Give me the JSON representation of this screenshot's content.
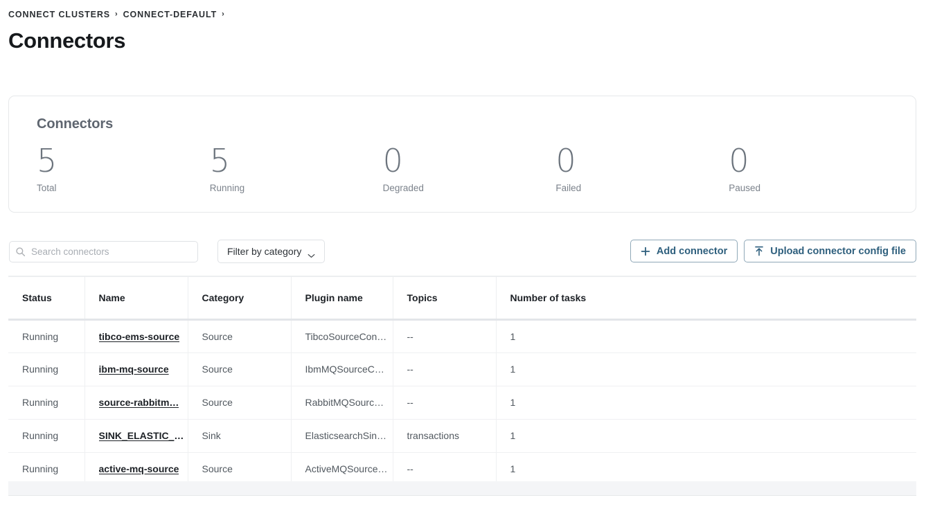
{
  "breadcrumb": {
    "items": [
      "CONNECT CLUSTERS",
      "CONNECT-DEFAULT"
    ],
    "separator": "›"
  },
  "page_title": "Connectors",
  "summary_card": {
    "title": "Connectors",
    "stats": [
      {
        "value": "5",
        "label": "Total"
      },
      {
        "value": "5",
        "label": "Running"
      },
      {
        "value": "0",
        "label": "Degraded"
      },
      {
        "value": "0",
        "label": "Failed"
      },
      {
        "value": "0",
        "label": "Paused"
      }
    ]
  },
  "toolbar": {
    "search_placeholder": "Search connectors",
    "search_value": "",
    "filter_label": "Filter by category",
    "add_connector_label": "Add connector",
    "upload_config_label": "Upload connector config file"
  },
  "table": {
    "columns": [
      "Status",
      "Name",
      "Category",
      "Plugin name",
      "Topics",
      "Number of tasks"
    ],
    "rows": [
      {
        "status": "Running",
        "name": "tibco-ems-source",
        "category": "Source",
        "plugin": "TibcoSourceCon…",
        "topics": "--",
        "tasks": "1"
      },
      {
        "status": "Running",
        "name": "ibm-mq-source",
        "category": "Source",
        "plugin": "IbmMQSourceC…",
        "topics": "--",
        "tasks": "1"
      },
      {
        "status": "Running",
        "name": "source-rabbitm…",
        "category": "Source",
        "plugin": "RabbitMQSourc…",
        "topics": "--",
        "tasks": "1"
      },
      {
        "status": "Running",
        "name": "SINK_ELASTIC_T…",
        "category": "Sink",
        "plugin": "ElasticsearchSin…",
        "topics": "transactions",
        "tasks": "1"
      },
      {
        "status": "Running",
        "name": "active-mq-source",
        "category": "Source",
        "plugin": "ActiveMQSource…",
        "topics": "--",
        "tasks": "1"
      }
    ]
  },
  "colors": {
    "accent": "#2e5f7d",
    "accent_border": "#8fa8b8",
    "title": "#16191c",
    "muted": "#7b828b",
    "border": "#e6e8ea"
  }
}
